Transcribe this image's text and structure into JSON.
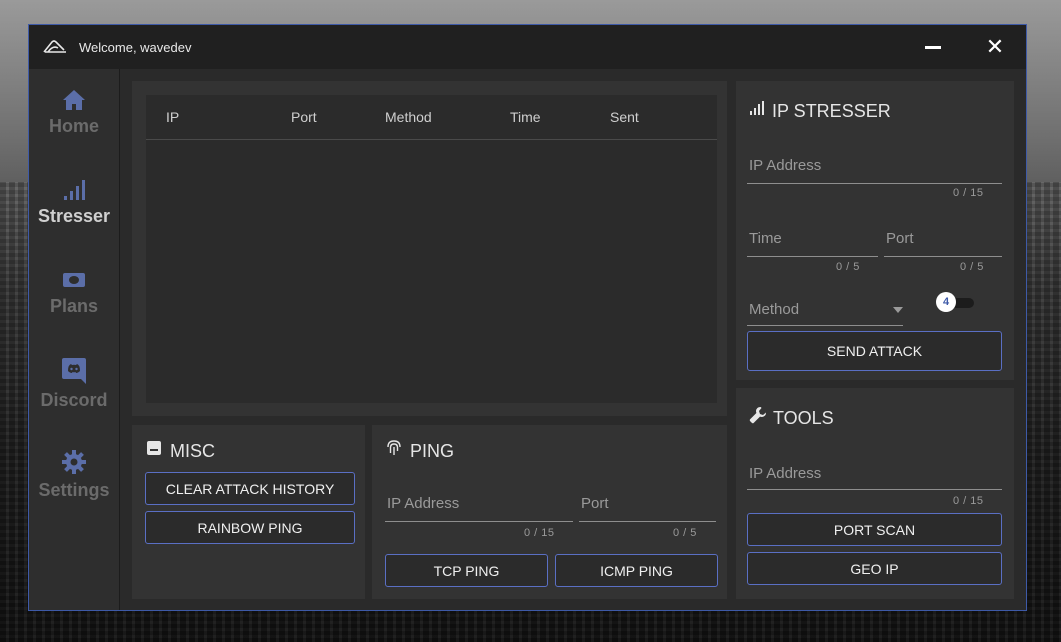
{
  "window": {
    "title": "Welcome, wavedev",
    "close_glyph": "✕"
  },
  "sidebar": {
    "items": [
      {
        "label": "Home",
        "icon": "home-icon"
      },
      {
        "label": "Stresser",
        "icon": "signal-bars-icon",
        "active": true
      },
      {
        "label": "Plans",
        "icon": "ticket-icon"
      },
      {
        "label": "Discord",
        "icon": "discord-icon"
      },
      {
        "label": "Settings",
        "icon": "gear-icon"
      }
    ]
  },
  "history_table": {
    "columns": [
      "IP",
      "Port",
      "Method",
      "Time",
      "Sent"
    ],
    "rows": []
  },
  "stresser": {
    "title": "IP STRESSER",
    "ip": {
      "placeholder": "IP Address",
      "counter": "0 / 15"
    },
    "time": {
      "placeholder": "Time",
      "counter": "0 / 5"
    },
    "port": {
      "placeholder": "Port",
      "counter": "0 / 5"
    },
    "method": {
      "placeholder": "Method"
    },
    "toggle_value": "4",
    "send_label": "SEND ATTACK"
  },
  "misc": {
    "title": "MISC",
    "clear_label": "CLEAR ATTACK HISTORY",
    "rainbow_label": "RAINBOW PING"
  },
  "ping": {
    "title": "PING",
    "ip": {
      "placeholder": "IP Address",
      "counter": "0 / 15"
    },
    "port": {
      "placeholder": "Port",
      "counter": "0 / 5"
    },
    "tcp_label": "TCP PING",
    "icmp_label": "ICMP PING"
  },
  "tools": {
    "title": "TOOLS",
    "ip": {
      "placeholder": "IP Address",
      "counter": "0 / 15"
    },
    "portscan_label": "PORT SCAN",
    "geoip_label": "GEO IP"
  },
  "colors": {
    "accent": "#5a6fc4",
    "nav_icon": "#5b6ea8",
    "window_border": "#3e5aa8"
  }
}
